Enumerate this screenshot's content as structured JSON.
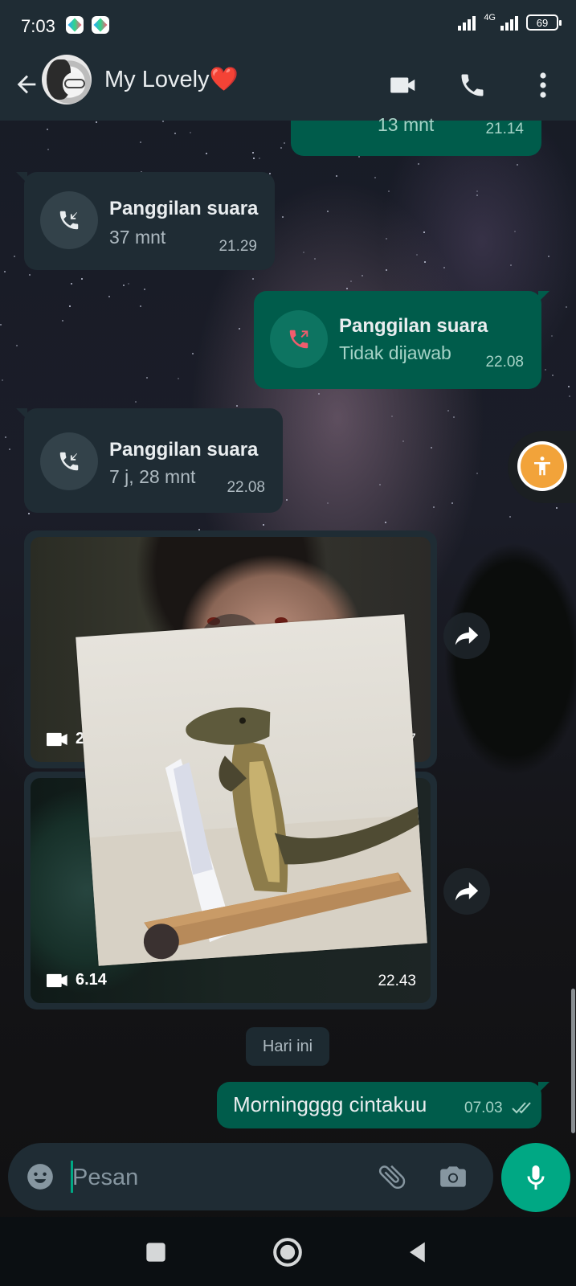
{
  "status_bar": {
    "time": "7:03",
    "network": "4G",
    "battery": "69"
  },
  "header": {
    "contact_name": "My Lovely",
    "contact_emoji": "❤️",
    "icons": [
      "back-arrow-icon",
      "video-call-icon",
      "voice-call-icon",
      "more-options-icon"
    ]
  },
  "messages": [
    {
      "type": "call",
      "direction": "out",
      "title": "",
      "subtitle": "13 mnt",
      "time": "21.14"
    },
    {
      "type": "call",
      "direction": "in",
      "title": "Panggilan suara",
      "subtitle": "37 mnt",
      "time": "21.29",
      "icon": "incoming-call-icon"
    },
    {
      "type": "call",
      "direction": "out",
      "title": "Panggilan suara",
      "subtitle": "Tidak dijawab",
      "time": "22.08",
      "icon": "missed-outgoing-call-icon"
    },
    {
      "type": "call",
      "direction": "in",
      "title": "Panggilan suara",
      "subtitle": "7 j, 28 mnt",
      "time": "22.08",
      "icon": "incoming-call-icon"
    },
    {
      "type": "video",
      "direction": "in",
      "duration": "2.5",
      "time": "7"
    },
    {
      "type": "video",
      "direction": "in",
      "duration": "6.14",
      "time": "22.43"
    },
    {
      "type": "text",
      "direction": "out",
      "text": "Morningggg cintakuu",
      "time": "07.03",
      "status": "read-double-check-icon"
    }
  ],
  "date_divider": "Hari ini",
  "composer": {
    "placeholder": "Pesan",
    "icons": [
      "emoji-icon",
      "attach-icon",
      "camera-icon",
      "mic-icon"
    ]
  },
  "colors": {
    "header_bg": "#1f2c34",
    "incoming_bubble": "#1f2c34",
    "outgoing_bubble": "#005c4b",
    "accent": "#00a884",
    "missed_call": "#f15c6d",
    "accessibility_button": "#f2a33a"
  }
}
